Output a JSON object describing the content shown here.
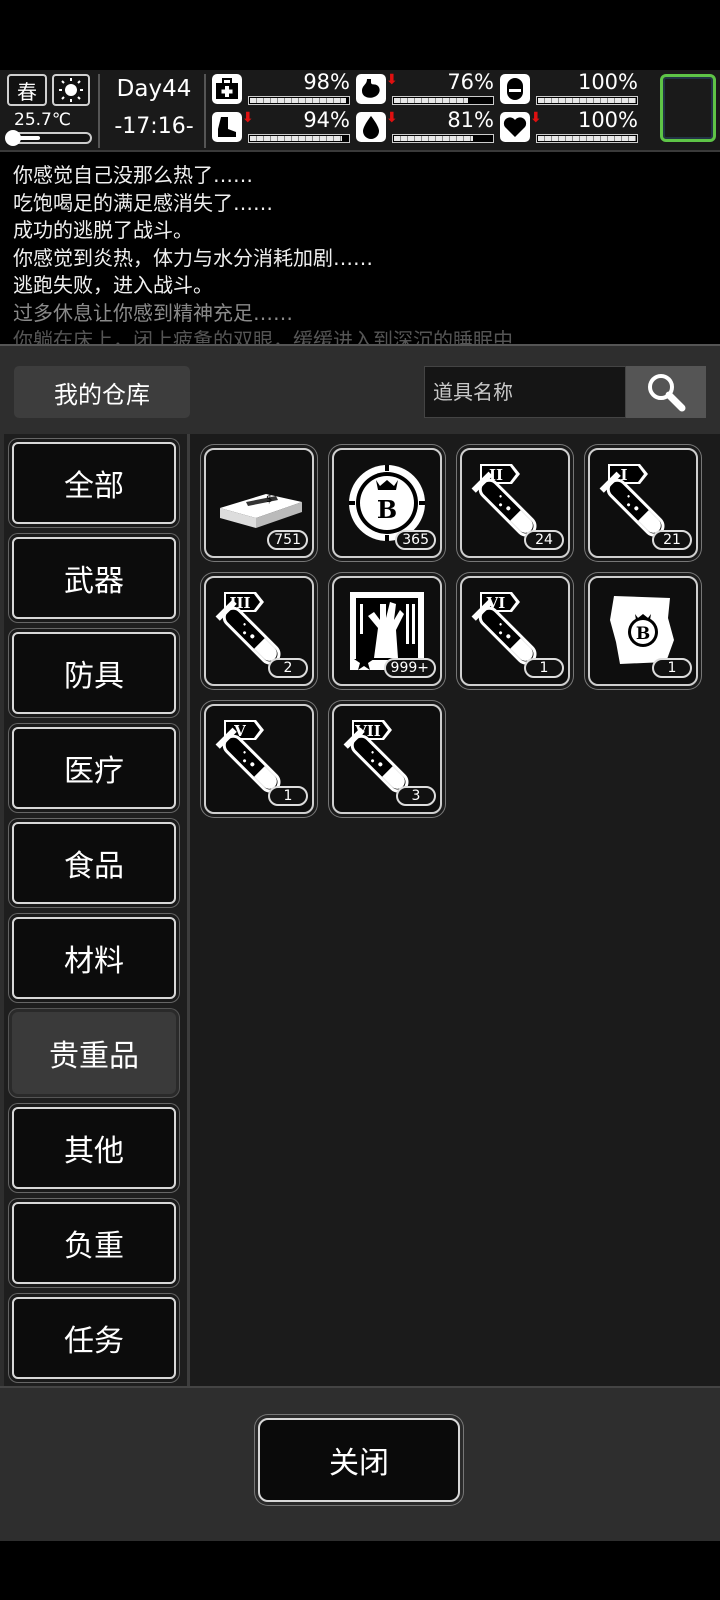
{
  "status": {
    "season": "春",
    "temperature": "25.7℃",
    "thermometer_level": 0.38,
    "day": "Day44",
    "time": "-17:16-",
    "stats": [
      {
        "icon": "medkit-icon",
        "value": "98%",
        "level": 0.98,
        "down": false
      },
      {
        "icon": "stomach-icon",
        "value": "76%",
        "level": 0.76,
        "down": true
      },
      {
        "icon": "pill-icon",
        "value": "100%",
        "level": 1.0,
        "down": false
      },
      {
        "icon": "boot-icon",
        "value": "94%",
        "level": 0.94,
        "down": true
      },
      {
        "icon": "water-drop-icon",
        "value": "81%",
        "level": 0.81,
        "down": true
      },
      {
        "icon": "heart-icon",
        "value": "100%",
        "level": 1.0,
        "down": true
      }
    ]
  },
  "log": {
    "lines": [
      "你感觉自己没那么热了……",
      "吃饱喝足的满足感消失了……",
      "成功的逃脱了战斗。",
      "你感觉到炎热，体力与水分消耗加剧……",
      "逃跑失败，进入战斗。",
      "过多休息让你感到精神充足……",
      "你躺在床上，闭上疲惫的双眼，缓缓进入到深沉的睡眠中……"
    ]
  },
  "warehouse": {
    "title": "我的仓库",
    "search_placeholder": "道具名称",
    "categories": [
      "全部",
      "武器",
      "防具",
      "医疗",
      "食品",
      "材料",
      "贵重品",
      "其他",
      "负重",
      "任务"
    ],
    "active_category": "贵重品",
    "items": [
      {
        "icon": "cash-bundle-icon",
        "qty": "751"
      },
      {
        "icon": "bitcoin-coin-icon",
        "qty": "365"
      },
      {
        "icon": "test-tube-ii-icon",
        "numeral": "II",
        "qty": "24"
      },
      {
        "icon": "test-tube-i-icon",
        "numeral": "I",
        "qty": "21"
      },
      {
        "icon": "test-tube-iii-icon",
        "numeral": "III",
        "qty": "2"
      },
      {
        "icon": "zombie-card-icon",
        "qty": "999+"
      },
      {
        "icon": "test-tube-vi-icon",
        "numeral": "VI",
        "qty": "1"
      },
      {
        "icon": "bitcoin-paper-icon",
        "qty": "1"
      },
      {
        "icon": "test-tube-v-icon",
        "numeral": "V",
        "qty": "1"
      },
      {
        "icon": "test-tube-vii-icon",
        "numeral": "VII",
        "qty": "3"
      }
    ],
    "close_label": "关闭"
  },
  "colors": {
    "accent_green": "#5ec447",
    "down_arrow": "#e01010",
    "panel_bg": "#2e2e2e"
  }
}
